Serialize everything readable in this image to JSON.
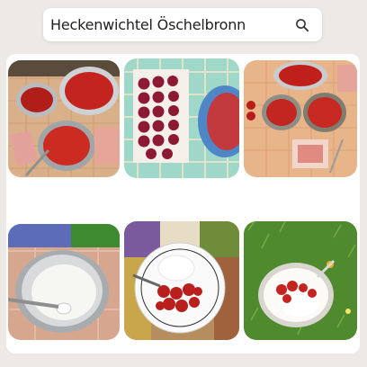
{
  "search": {
    "query": "Heckenwichtel Öschelbronn",
    "icon": "magnifier-icon"
  },
  "gallery": {
    "images": [
      {
        "id": "strawberry-bowls-on-checkered-cloth"
      },
      {
        "id": "plums-on-cutting-board"
      },
      {
        "id": "strawberry-bowls-overhead"
      },
      {
        "id": "yogurt-in-metal-bowl"
      },
      {
        "id": "strawberries-on-plate-with-yogurt"
      },
      {
        "id": "strawberry-yogurt-on-grass"
      }
    ]
  },
  "colors": {
    "background": "#ece9e6",
    "panel": "#ffffff",
    "strawberry": "#c8221e",
    "tablecloth": "#e8b58f",
    "grass": "#4f8a2f"
  }
}
